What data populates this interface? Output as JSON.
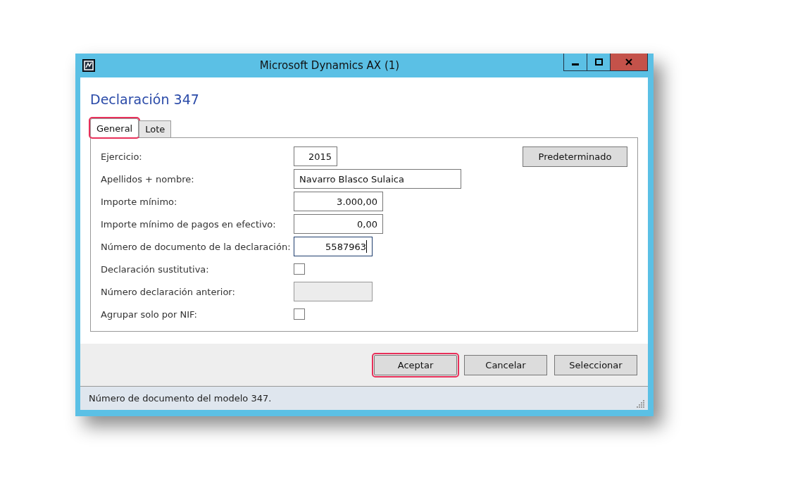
{
  "window": {
    "title": "Microsoft Dynamics AX (1)"
  },
  "heading": "Declaración 347",
  "tabs": [
    {
      "label": "General",
      "selected": true,
      "highlighted": true
    },
    {
      "label": "Lote",
      "selected": false,
      "highlighted": false
    }
  ],
  "fields": [
    {
      "kind": "number",
      "label": "Ejercicio:",
      "value": "2015",
      "focused": false
    },
    {
      "kind": "text",
      "label": "Apellidos + nombre:",
      "value": "Navarro Blasco Sulaica",
      "focused": false
    },
    {
      "kind": "number",
      "label": "Importe mínimo:",
      "value": "3.000,00",
      "focused": false
    },
    {
      "kind": "number",
      "label": "Importe mínimo de pagos en efectivo:",
      "value": "0,00",
      "focused": false
    },
    {
      "kind": "number",
      "label": "Número de documento de la declaración:",
      "value": "5587963",
      "focused": true
    },
    {
      "kind": "checkbox",
      "label": "Declaración sustitutiva:",
      "checked": false
    },
    {
      "kind": "disabled",
      "label": "Número declaración anterior:"
    },
    {
      "kind": "checkbox",
      "label": "Agrupar solo por NIF:",
      "checked": false
    }
  ],
  "side_button": "Predeterminado",
  "buttons": [
    {
      "label": "Aceptar",
      "highlighted": true
    },
    {
      "label": "Cancelar",
      "highlighted": false
    },
    {
      "label": "Seleccionar",
      "highlighted": false
    }
  ],
  "status_bar": "Número de documento del modelo 347."
}
